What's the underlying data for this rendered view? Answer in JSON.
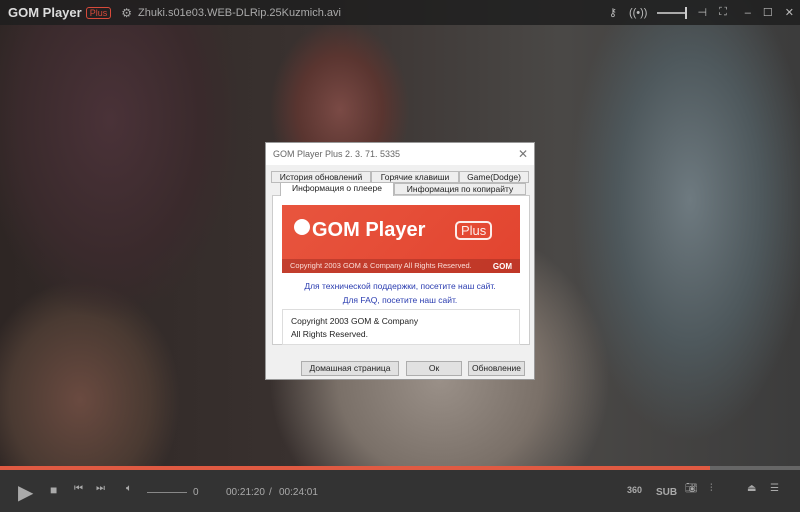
{
  "app": {
    "name": "GOM Player",
    "badge": "Plus",
    "filename": "Zhuki.s01e03.WEB-DLRip.25Kuzmich.avi"
  },
  "topbar_icons": [
    "key-icon",
    "broadcast-icon",
    "volume-slider",
    "pin-icon",
    "fullscreen-icon",
    "minimize-icon",
    "maximize-icon",
    "close-icon"
  ],
  "playback": {
    "progress": 0.888,
    "current_time": "00:21:20",
    "separator": "/",
    "total_time": "00:24:01",
    "volume": "0"
  },
  "controls": {
    "vr": "360",
    "sub": "SUB"
  },
  "dialog": {
    "title": "GOM Player Plus 2. 3. 71. 5335",
    "tabs_row1": [
      "История обновлений",
      "Горячие клавиши",
      "Game(Dodge)"
    ],
    "tabs_row2": [
      "Информация о плеере",
      "Информация по копирайту"
    ],
    "banner": {
      "title": "GOM Player",
      "badge": "Plus",
      "copyright": "Copyright 2003 GOM & Company All Rights Reserved.",
      "brand": "GOM"
    },
    "support_link": "Для технической поддержки, посетите наш сайт.",
    "faq_link": "Для FAQ, посетите наш сайт.",
    "copyright_lines": [
      "Copyright 2003 GOM & Company",
      "All Rights Reserved."
    ],
    "buttons": {
      "home": "Домашная страница",
      "ok": "Ок",
      "update": "Обновление"
    }
  },
  "colors": {
    "accent": "#e05a42",
    "link": "#2a3cb0"
  }
}
